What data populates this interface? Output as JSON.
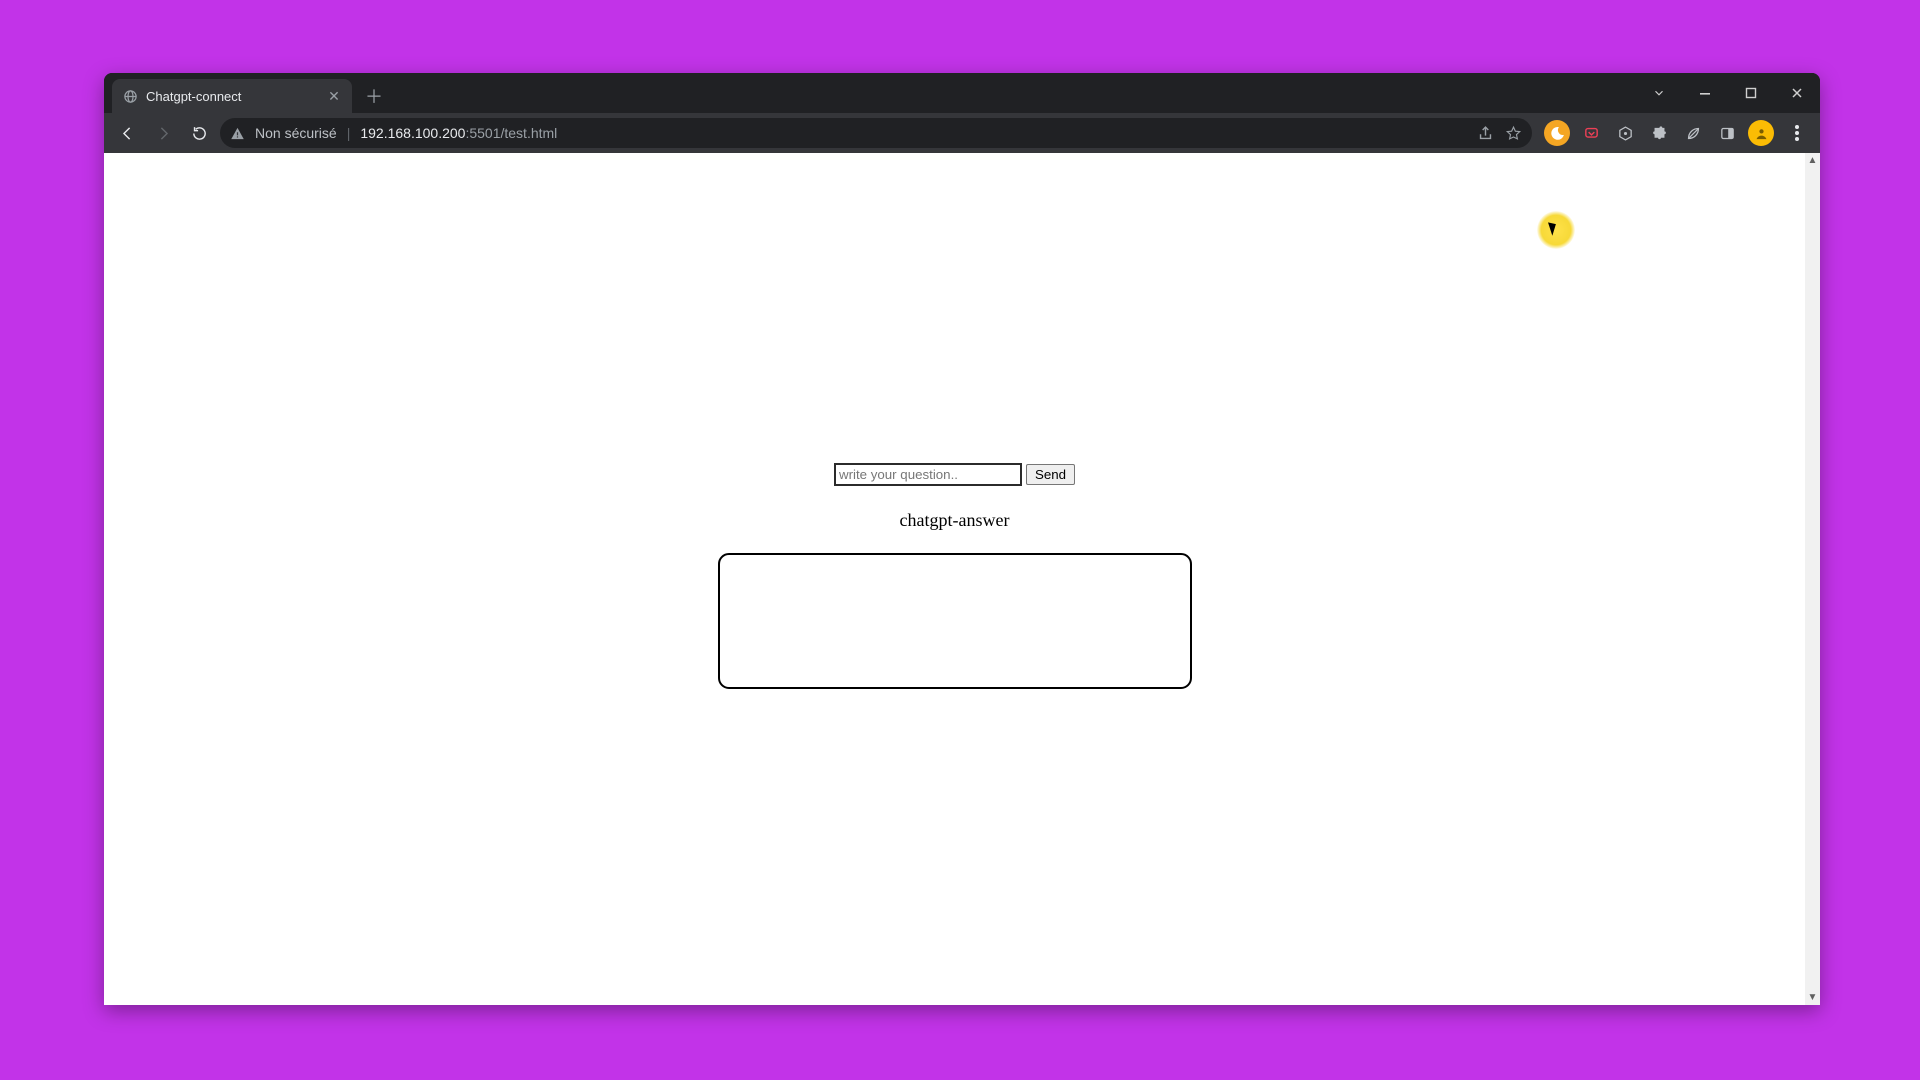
{
  "tab": {
    "title": "Chatgpt-connect"
  },
  "address": {
    "security_label": "Non sécurisé",
    "url_host": "192.168.100.200",
    "url_port_path": ":5501/test.html"
  },
  "page": {
    "input_placeholder": "write your question..",
    "send_label": "Send",
    "answer_label": "chatgpt-answer",
    "answer_text": ""
  }
}
